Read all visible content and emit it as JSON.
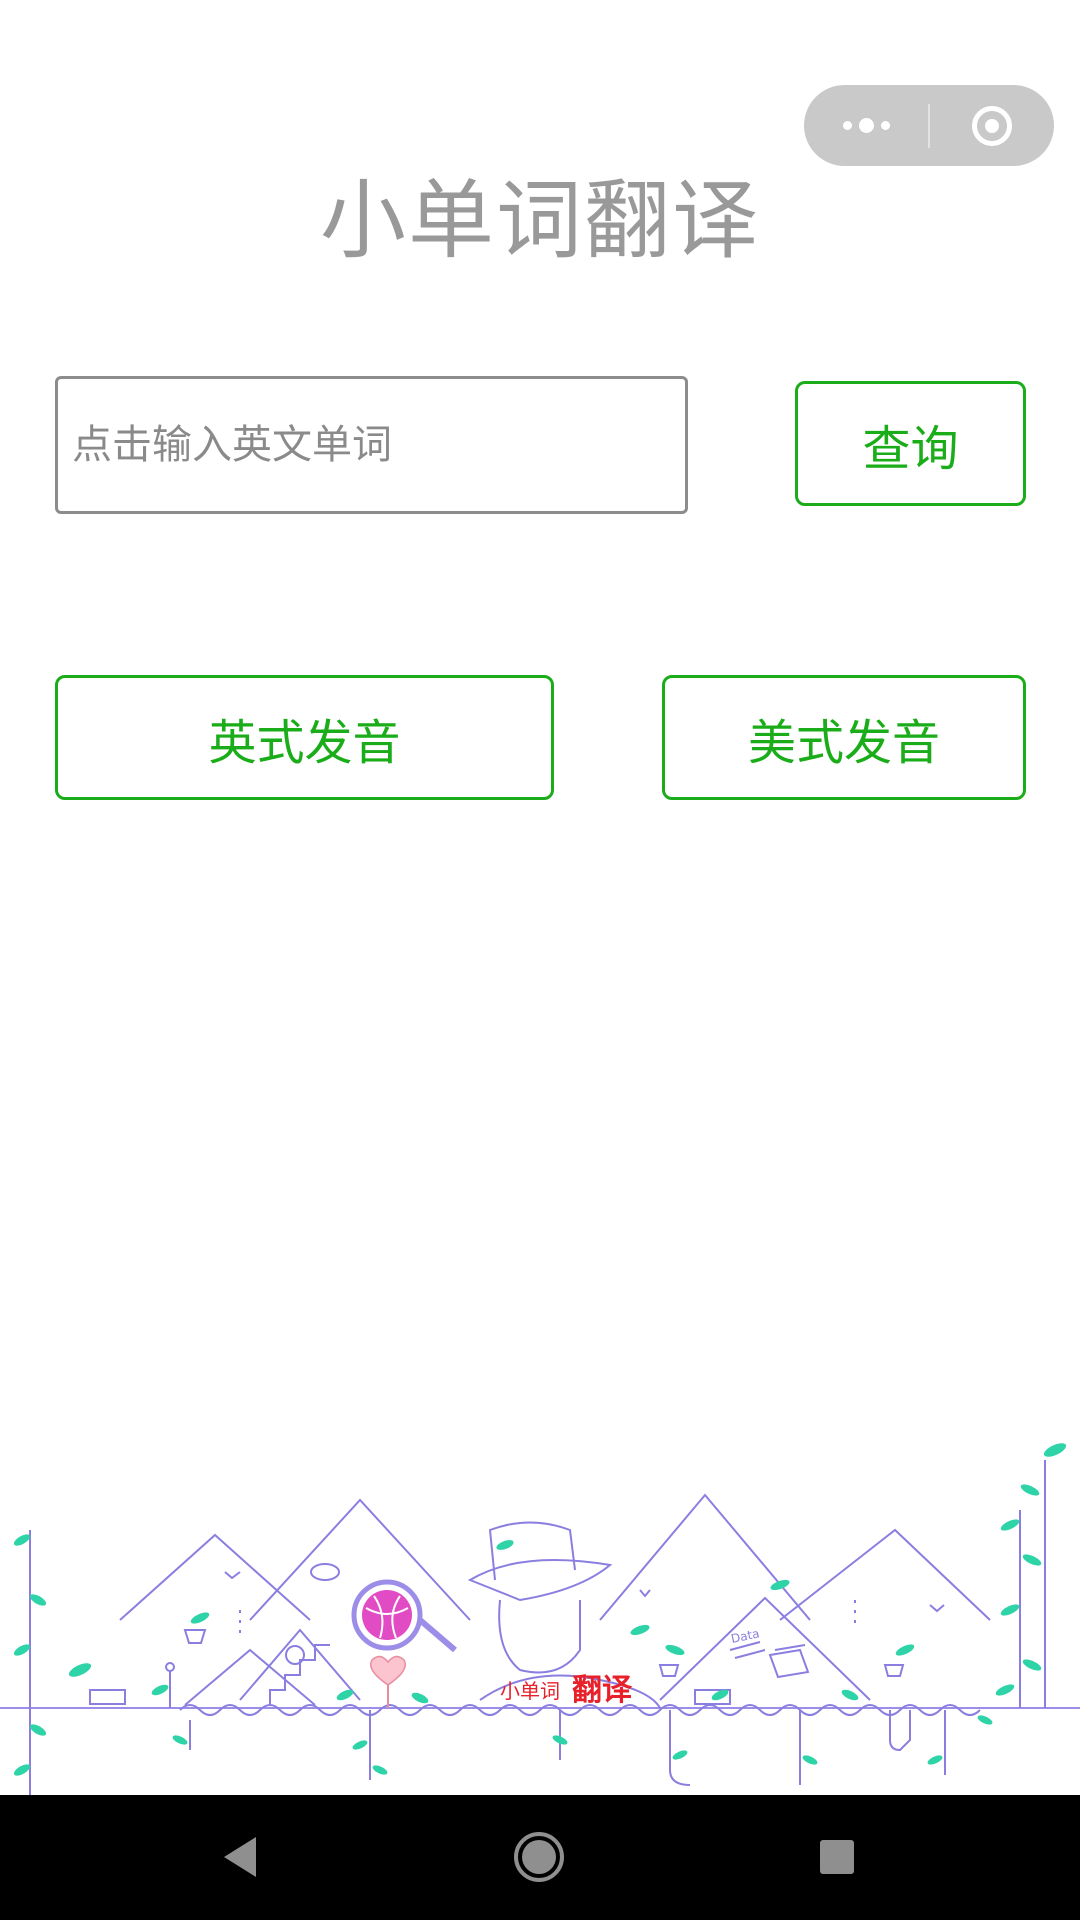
{
  "app": {
    "title": "小单词翻译"
  },
  "capsule": {
    "more_icon": "more-dots-icon",
    "close_icon": "target-close-icon"
  },
  "search": {
    "placeholder": "点击输入英文单词",
    "value": "",
    "query_label": "查询"
  },
  "pronunciation": {
    "uk_label": "英式发音",
    "us_label": "美式发音"
  },
  "illustration": {
    "logo_small": "小单词",
    "logo_big": "翻译",
    "tag_text": "Data"
  },
  "navbar": {
    "back_icon": "back-triangle-icon",
    "home_icon": "home-circle-icon",
    "recent_icon": "recent-square-icon"
  },
  "colors": {
    "accent": "#1aad19",
    "title": "#999999",
    "input_border": "#8c8c8c",
    "capsule": "#c9c9c9",
    "line_art": "#8a7fe0",
    "leaf": "#2ed3a8",
    "logo_red": "#e8202a"
  }
}
